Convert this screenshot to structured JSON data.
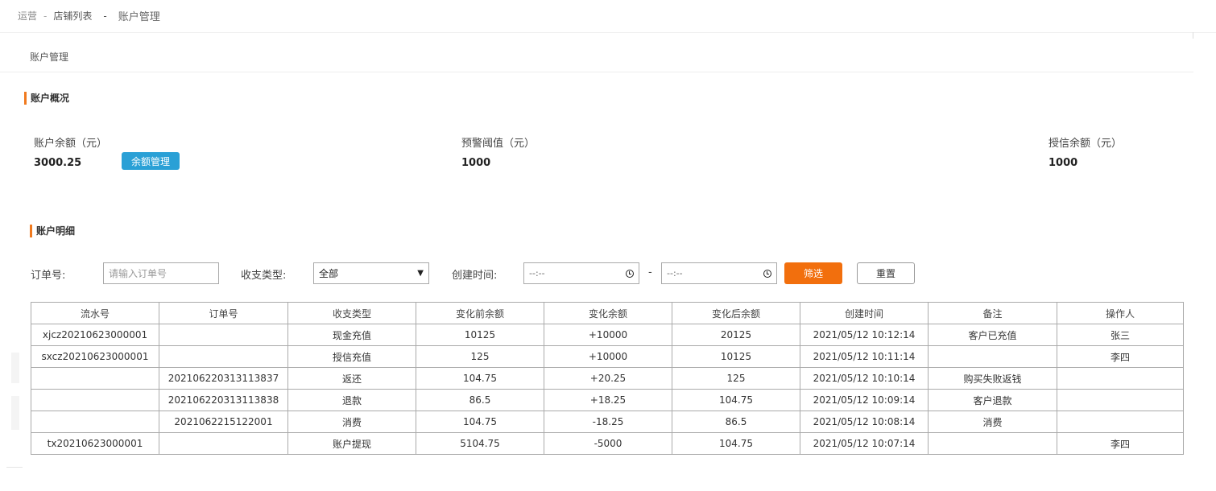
{
  "breadcrumb": {
    "items": [
      "运营",
      "店铺列表",
      "账户管理"
    ],
    "separators": [
      "-",
      "-"
    ]
  },
  "tab": {
    "label": "账户管理"
  },
  "overview": {
    "title": "账户概况",
    "balance": {
      "label": "账户余额（元）",
      "value": "3000.25",
      "button": "余额管理"
    },
    "warning": {
      "label": "预警阈值（元）",
      "value": "1000"
    },
    "credit": {
      "label": "授信余额（元）",
      "value": "1000"
    }
  },
  "detail": {
    "title": "账户明细",
    "filters": {
      "order_label": "订单号:",
      "order_placeholder": "请输入订单号",
      "type_label": "收支类型:",
      "type_selected": "全部",
      "time_label": "创建时间:",
      "time_start": "--:--",
      "time_end": "--:--",
      "range_sep": "-",
      "filter_button": "筛选",
      "reset_button": "重置"
    },
    "columns": [
      "流水号",
      "订单号",
      "收支类型",
      "变化前余额",
      "变化余额",
      "变化后余额",
      "创建时间",
      "备注",
      "操作人"
    ],
    "rows": [
      [
        "xjcz20210623000001",
        "",
        "现金充值",
        "10125",
        "+10000",
        "20125",
        "2021/05/12 10:12:14",
        "客户已充值",
        "张三"
      ],
      [
        "sxcz20210623000001",
        "",
        "授信充值",
        "125",
        "+10000",
        "10125",
        "2021/05/12 10:11:14",
        "",
        "李四"
      ],
      [
        "",
        "202106220313113837",
        "返还",
        "104.75",
        "+20.25",
        "125",
        "2021/05/12 10:10:14",
        "购买失败返钱",
        ""
      ],
      [
        "",
        "202106220313113838",
        "退款",
        "86.5",
        "+18.25",
        "104.75",
        "2021/05/12 10:09:14",
        "客户退款",
        ""
      ],
      [
        "",
        "2021062215122001",
        "消费",
        "104.75",
        "-18.25",
        "86.5",
        "2021/05/12 10:08:14",
        "消费",
        ""
      ],
      [
        "tx20210623000001",
        "",
        "账户提现",
        "5104.75",
        "-5000",
        "104.75",
        "2021/05/12 10:07:14",
        "",
        "李四"
      ]
    ]
  },
  "colors": {
    "accent_orange": "#f26f0d",
    "section_marker": "#f07a1f",
    "balance_button": "#2aa0d6"
  },
  "icons": {
    "time_picker": "clock-icon",
    "select": "chevron-down-icon"
  }
}
